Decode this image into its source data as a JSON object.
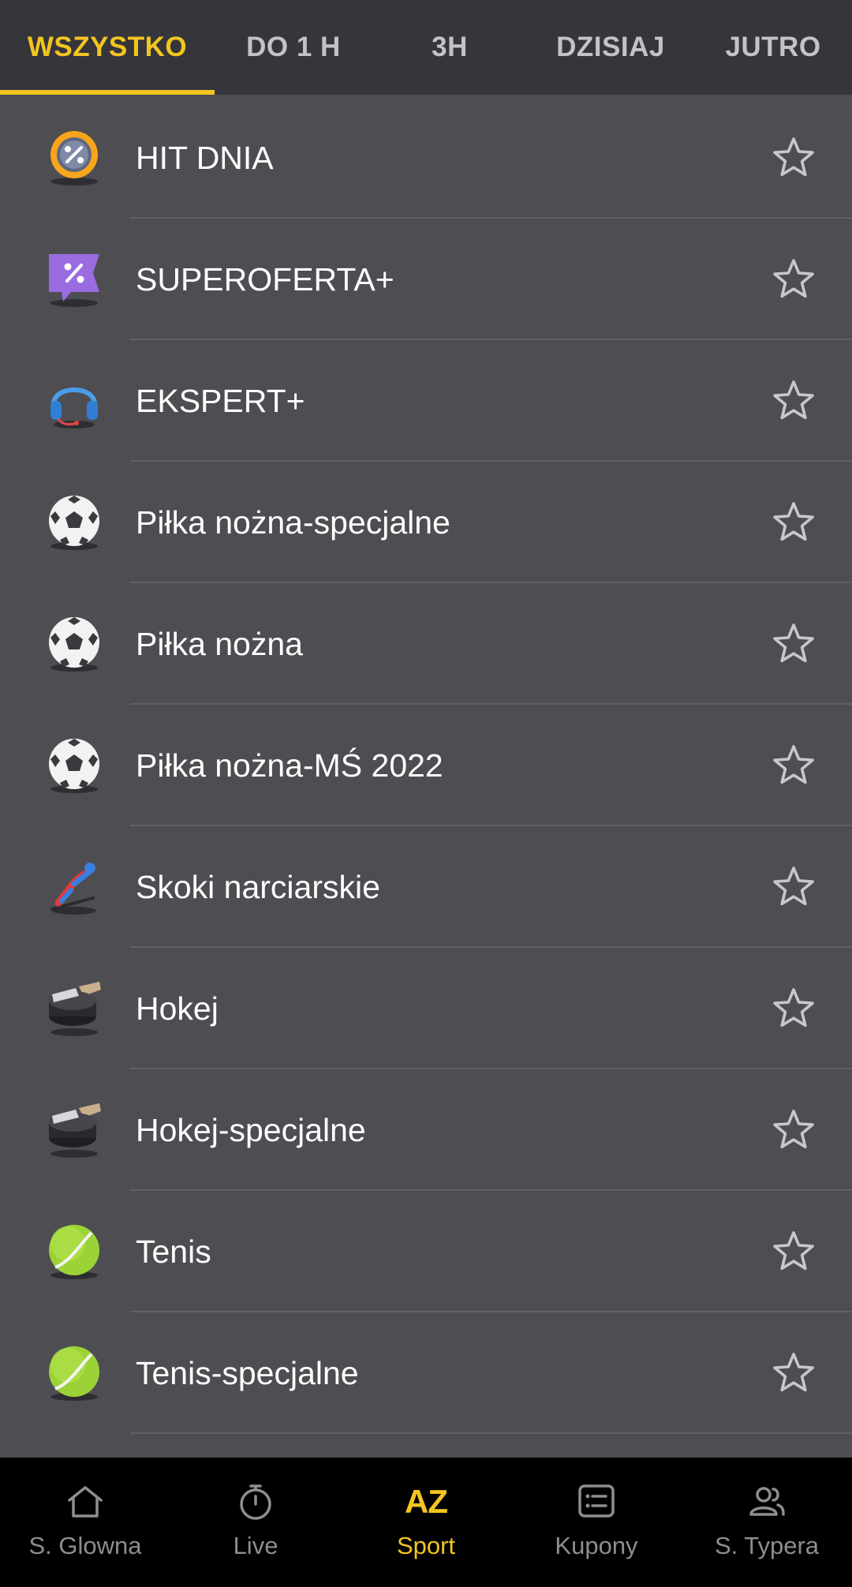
{
  "tabs": [
    {
      "label": "WSZYSTKO",
      "active": true
    },
    {
      "label": "DO 1 H",
      "active": false
    },
    {
      "label": "3H",
      "active": false
    },
    {
      "label": "DZISIAJ",
      "active": false
    },
    {
      "label": "JUTRO",
      "active": false
    }
  ],
  "colors": {
    "accent": "#f3c520",
    "background": "#4e4d52",
    "tabbar": "#35353a",
    "navbar": "#000000"
  },
  "sports": [
    {
      "label": "HIT DNIA",
      "icon": "percent-badge-icon"
    },
    {
      "label": "SUPEROFERTA+",
      "icon": "percent-tag-icon"
    },
    {
      "label": "EKSPERT+",
      "icon": "headset-icon"
    },
    {
      "label": "Piłka nożna-specjalne",
      "icon": "soccer-ball-icon"
    },
    {
      "label": "Piłka nożna",
      "icon": "soccer-ball-icon"
    },
    {
      "label": "Piłka nożna-MŚ 2022",
      "icon": "soccer-ball-icon"
    },
    {
      "label": "Skoki narciarskie",
      "icon": "ski-jumper-icon"
    },
    {
      "label": "Hokej",
      "icon": "hockey-puck-icon"
    },
    {
      "label": "Hokej-specjalne",
      "icon": "hockey-puck-icon"
    },
    {
      "label": "Tenis",
      "icon": "tennis-ball-icon"
    },
    {
      "label": "Tenis-specjalne",
      "icon": "tennis-ball-icon"
    }
  ],
  "bottom_nav": {
    "home": "S. Glowna",
    "live": "Live",
    "sport_icon_text": "AZ",
    "sport": "Sport",
    "coupons": "Kupony",
    "typers": "S. Typera"
  }
}
